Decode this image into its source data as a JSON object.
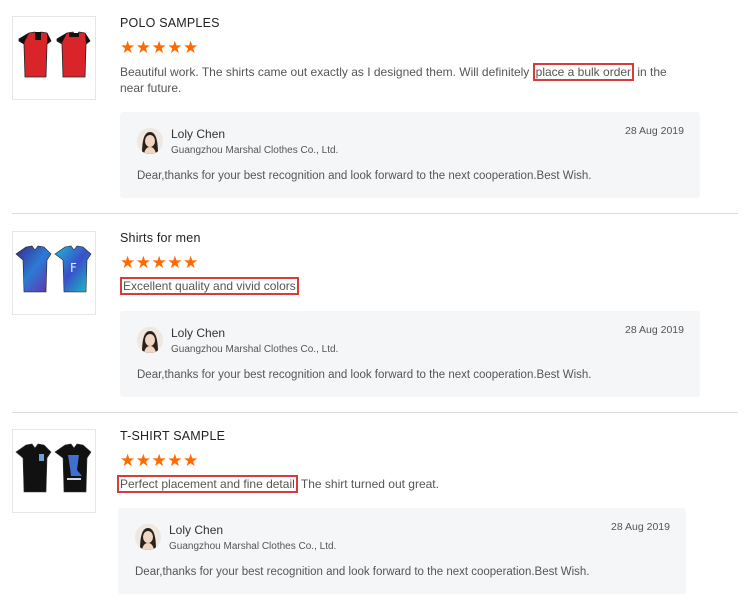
{
  "reviews": [
    {
      "title": "POLO SAMPLES",
      "stars": "★★★★★",
      "comment_before": "Beautiful work.  The shirts came out exactly as I designed them.  Will definitely ",
      "comment_highlight": "place a bulk order",
      "comment_after": " in the near future.",
      "reply": {
        "name": "Loly Chen",
        "company": "Guangzhou Marshal Clothes Co., Ltd.",
        "date": "28 Aug 2019",
        "text": "Dear,thanks for your best recognition and look forward to the next cooperation.Best Wish."
      }
    },
    {
      "title": "Shirts for men",
      "stars": "★★★★★",
      "comment_before": "",
      "comment_highlight": "Excellent quality and vivid colors",
      "comment_after": "",
      "reply": {
        "name": "Loly Chen",
        "company": "Guangzhou Marshal Clothes Co., Ltd.",
        "date": "28 Aug 2019",
        "text": "Dear,thanks for your best recognition and look forward to the next cooperation.Best Wish."
      }
    },
    {
      "title": "T-SHIRT SAMPLE",
      "stars": "★★★★★",
      "comment_before": "",
      "comment_highlight": "Perfect placement and fine detail",
      "comment_after": "  The shirt turned out great.",
      "reply": {
        "name": "Loly Chen",
        "company": "Guangzhou Marshal Clothes Co., Ltd.",
        "date": "28 Aug 2019",
        "text": "Dear,thanks for your best recognition and look forward to the next cooperation.Best Wish."
      }
    }
  ],
  "colors": {
    "star": "#ff6a00",
    "highlight_border": "#d93a3a",
    "reply_bg": "#f5f6f8"
  },
  "icons": [
    "polo-shirt-thumbnail",
    "sublimated-shirt-thumbnail",
    "black-tshirt-thumbnail",
    "avatar"
  ]
}
